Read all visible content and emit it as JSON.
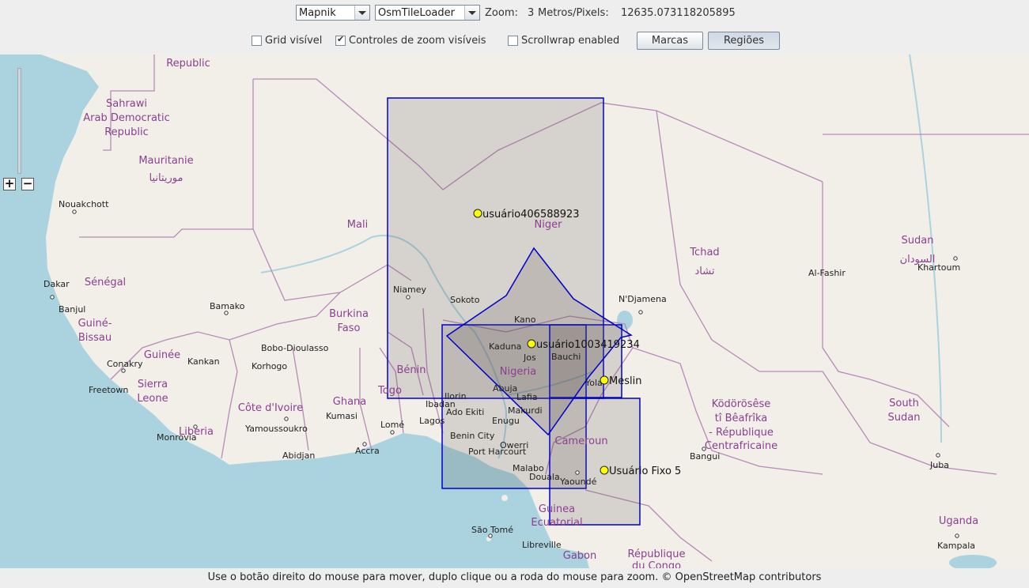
{
  "toolbar": {
    "tile_source": "Mapnik",
    "tile_loader": "OsmTileLoader",
    "zoom_label": "Zoom:",
    "zoom_value": "3",
    "meters_label": "Metros/Pixels:",
    "meters_value": "12635.073118205895",
    "grid_label": "Grid visível",
    "grid_checked": false,
    "zoom_controls_label": "Controles de zoom visíveis",
    "zoom_controls_checked": true,
    "scrollwrap_label": "Scrollwrap enabled",
    "scrollwrap_checked": false,
    "marks_button": "Marcas",
    "regions_button": "Regiões"
  },
  "map": {
    "markers": [
      {
        "label": "usuário406588923"
      },
      {
        "label": "usuário1003419234"
      },
      {
        "label": "Meslin"
      },
      {
        "label": "Usuário Fixo 5"
      }
    ],
    "countries": [
      "Sahrawi Arab Democratic Republic",
      "Republic",
      "Mauritanie",
      "موريتانيا",
      "Mali",
      "Niger",
      "Nigeria",
      "Burkina Faso",
      "Sénégal",
      "Guiné-Bissau",
      "Guinée",
      "Sierra Leone",
      "Liberia",
      "Côte d'Ivoire",
      "Ghana",
      "Togo",
      "Bénin",
      "Cameroun",
      "Guinea Ecuatorial",
      "Gabon",
      "Tchad",
      "تشاد",
      "Sudan",
      "السودان",
      "Ködörösêse tî Bêafrîka - République Centrafricaine",
      "South Sudan",
      "Uganda",
      "République du Congo"
    ],
    "cities": [
      "Nouakchott",
      "Dakar",
      "Banjul",
      "Bamako",
      "Conakry",
      "Freetown",
      "Monrovia",
      "Yamoussoukro",
      "Abidjan",
      "Kumasi",
      "Accra",
      "Lomé",
      "Lagos",
      "Ibadan",
      "Niamey",
      "Sokoto",
      "Kano",
      "Kaduna",
      "Jos",
      "Bauchi",
      "Abuja",
      "Lafia",
      "Makurdi",
      "Enugu",
      "Ado Ekiti",
      "Benin City",
      "Owerri",
      "Port Harcourt",
      "Malabo",
      "Douala",
      "Yaoundé",
      "São Tomé",
      "Libreville",
      "N'Djamena",
      "Bangui",
      "Juba",
      "Kampala",
      "Khartoum",
      "Al-Fashir",
      "Bobo-Dioulasso",
      "Korhogo",
      "Kankan",
      "Ilorin",
      "Yola"
    ]
  },
  "status": "Use o botão direito do mouse para mover, duplo clique ou a roda do mouse para zoom. © OpenStreetMap contributors"
}
